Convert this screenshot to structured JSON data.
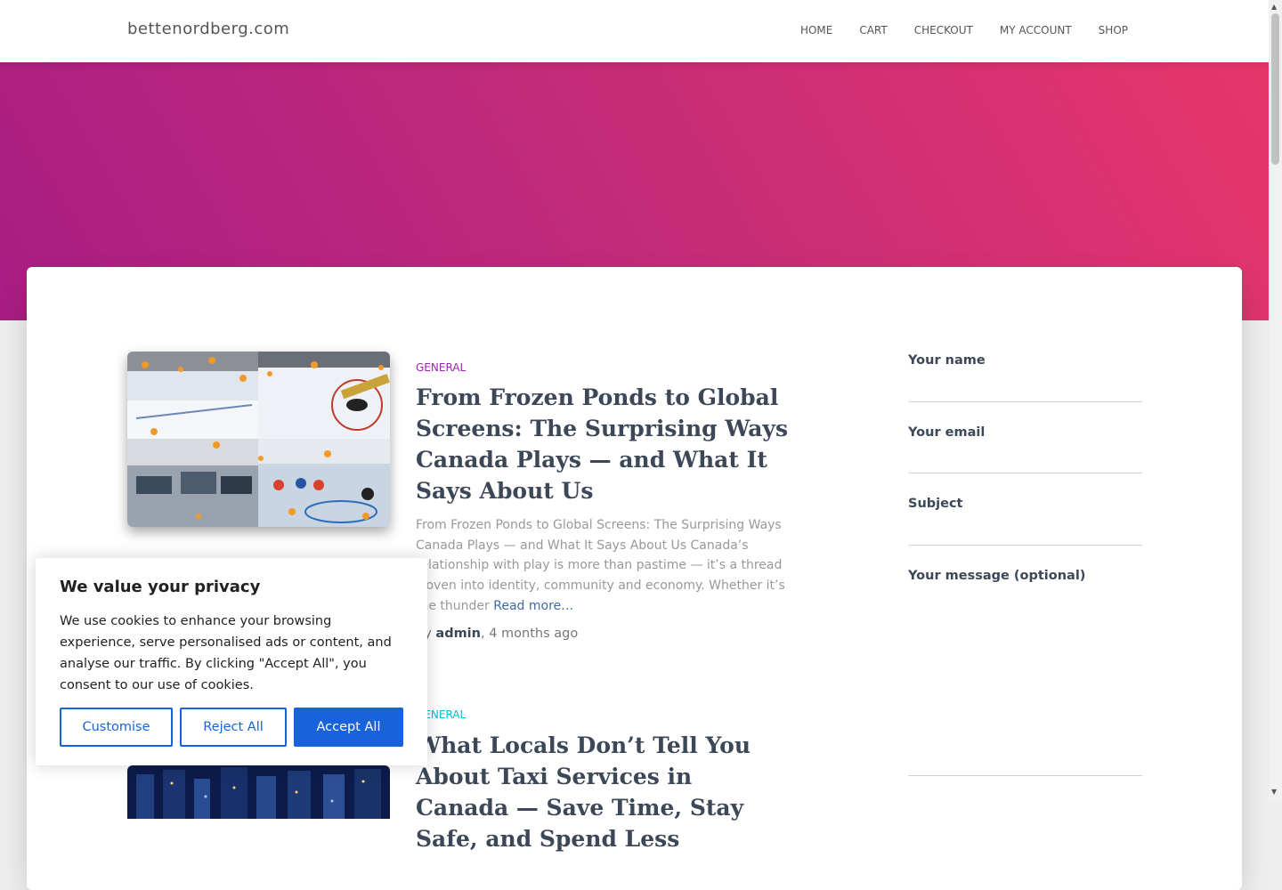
{
  "site": {
    "brand": "bettenordberg.com"
  },
  "nav": {
    "items": [
      "HOME",
      "CART",
      "CHECKOUT",
      "MY ACCOUNT",
      "SHOP"
    ]
  },
  "posts": [
    {
      "category": "GENERAL",
      "category_color": "#9c27b0",
      "title": "From Frozen Ponds to Global Screens: The Surprising Ways Canada Plays — and What It Says About Us",
      "excerpt": "From Frozen Ponds to Global Screens: The Surprising Ways Canada Plays — and What It Says About Us Canada’s relationship with play is more than pastime — it’s a thread woven into identity, community and economy. Whether it’s the thunder ",
      "read_more": "Read more…",
      "author_prefix": "by ",
      "author": "admin",
      "date": ", 4 months ago"
    },
    {
      "category": "GENERAL",
      "category_color": "#00bcd4",
      "title": "What Locals Don’t Tell You About Taxi Services in Canada — Save Time, Stay Safe, and Spend Less"
    }
  ],
  "contact_form": {
    "name_label": "Your name",
    "email_label": "Your email",
    "subject_label": "Subject",
    "message_label": "Your message (optional)"
  },
  "cookie": {
    "title": "We value your privacy",
    "text": "We use cookies to enhance your browsing experience, serve personalised ads or content, and analyse our traffic. By clicking \"Accept All\", you consent to our use of cookies.",
    "customise": "Customise",
    "reject": "Reject All",
    "accept": "Accept All"
  }
}
